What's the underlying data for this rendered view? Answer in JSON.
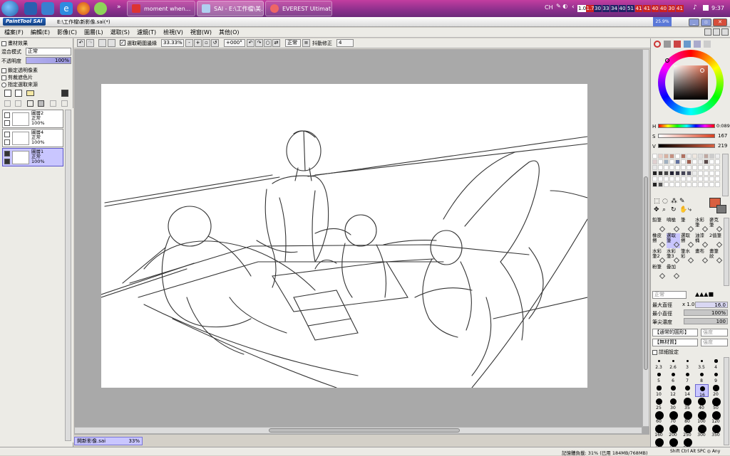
{
  "taskbar": {
    "tasks": [
      {
        "label": "moment when..."
      },
      {
        "label": "SAI - E:\\工作檔\\美..."
      },
      {
        "label": "EVEREST Ultimat..."
      }
    ],
    "language": "CH",
    "temps": [
      "1.0",
      "1.7",
      "30",
      "33",
      "34",
      "40",
      "51",
      "41",
      "41",
      "40",
      "40",
      "30",
      "41"
    ],
    "time": "9:37"
  },
  "titlebar": {
    "logo": "PaintTool SAI",
    "path": "E:\\工作檔\\新影像.sai(*)",
    "overlay": "25.9%"
  },
  "menu": [
    "檔案(F)",
    "編輯(E)",
    "影像(C)",
    "圖層(L)",
    "選取(S)",
    "濾鏡(T)",
    "檢視(V)",
    "視窗(W)",
    "其他(O)"
  ],
  "toolbar": {
    "antialias_label": "選取範圍邊緣",
    "zoom": "33.33%",
    "angle": "+000°",
    "blend": "正常",
    "stabilizer_label": "抖動修正",
    "stabilizer_value": "4"
  },
  "left": {
    "texture_label": "畫材效果",
    "blend_label": "混合模式",
    "blend_value": "正常",
    "opacity_label": "不透明度",
    "opacity_value": "100%",
    "opt1": "鎖定透明像素",
    "opt2": "剪裁遮色片",
    "opt3": "指定選取來源",
    "layers": [
      {
        "name": "圖層2",
        "mode": "正常",
        "opacity": "100%"
      },
      {
        "name": "圖層4",
        "mode": "正常",
        "opacity": "100%"
      },
      {
        "name": "圖層1",
        "mode": "正常",
        "opacity": "100%"
      }
    ]
  },
  "right": {
    "h_value": "0:089",
    "s_value": "167",
    "v_value": "219",
    "tools": [
      "鉛筆",
      "噴槍",
      "筆",
      "水彩筆",
      "麥克筆",
      "橡皮擦",
      "選取筆",
      "選取擦",
      "油漆桶",
      "2值筆",
      "水彩筆2",
      "水彩筆3",
      "筆水彩",
      "畫布",
      "畫筆紋",
      "粉筆",
      "疊加"
    ],
    "blend_mode": "正常",
    "max_size_label": "最大直徑",
    "max_size_mult": "x 1.0",
    "max_size_value": "16.0",
    "min_size_label": "最小直徑",
    "min_size_value": "100%",
    "density_label": "筆尖濃度",
    "density_value": "100",
    "shape_label": "【通常的圓形】",
    "shape_value": "強度",
    "texture_label": "【無材質】",
    "texture_value": "強度",
    "detail_label": "詳細設定",
    "sizes": [
      "2.3",
      "2.6",
      "3",
      "3.5",
      "4",
      "5",
      "6",
      "7",
      "8",
      "9",
      "10",
      "12",
      "14",
      "16",
      "20",
      "25",
      "30",
      "35",
      "40",
      "50",
      "60",
      "70",
      "80",
      "100",
      "120",
      "160",
      "200",
      "250",
      "300",
      "350",
      "400",
      "450",
      "500"
    ]
  },
  "status": {
    "doc": "開新影像.sai",
    "zoom": "33%",
    "memory": "記憶體負載: 31% (已用 184MB/768MB)",
    "keys": "Shift Ctrl Alt SPC ◎ Any"
  }
}
